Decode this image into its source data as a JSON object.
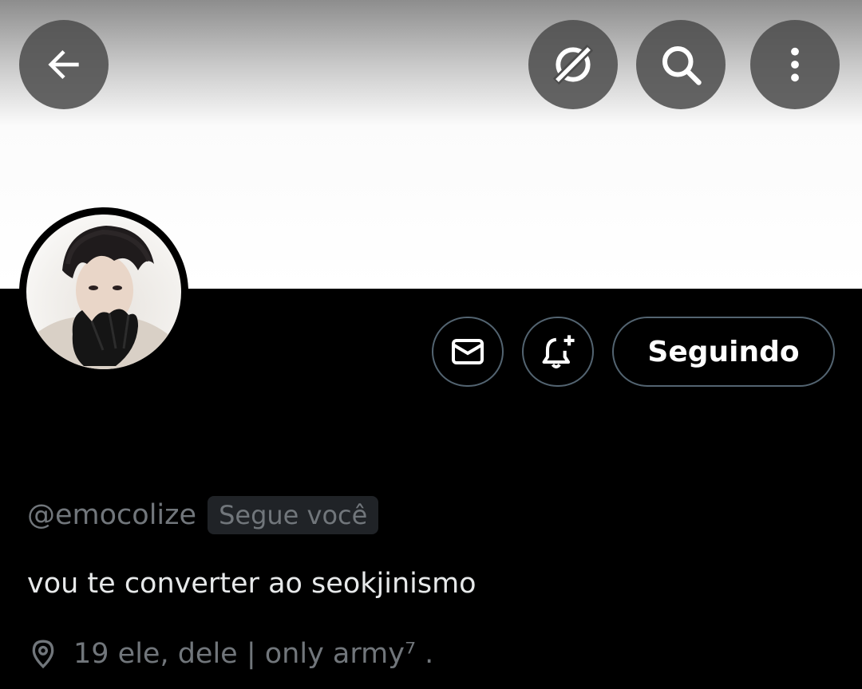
{
  "header": {
    "back_icon": "arrow-left-icon",
    "grok_icon": "grok-icon",
    "search_icon": "search-icon",
    "more_icon": "more-vertical-icon"
  },
  "profile": {
    "handle": "@emocolize",
    "follows_you_badge": "Segue você",
    "bio": "vou te converter ao seokjinismo",
    "location": "19 ele, dele | only army⁷ .",
    "location_icon": "location-pin-icon"
  },
  "actions": {
    "message_icon": "envelope-icon",
    "notify_icon": "bell-plus-icon",
    "following_label": "Seguindo"
  },
  "colors": {
    "background": "#000000",
    "secondary_text": "#71767b",
    "primary_text": "#e7e9ea",
    "button_border": "#536471"
  }
}
